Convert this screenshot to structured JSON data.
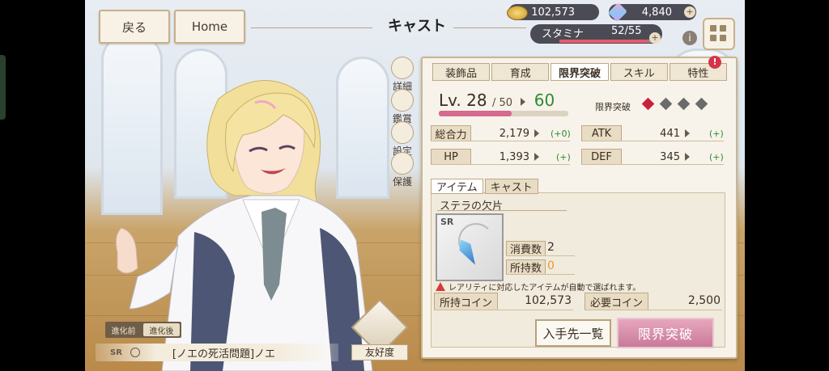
{
  "header": {
    "back_label": "戻る",
    "home_label": "Home",
    "title": "キャスト",
    "coins": "102,573",
    "gems": "4,840",
    "stamina_label": "スタミナ",
    "stamina_value": "52/55",
    "stamina_fraction": 0.945,
    "info_symbol": "i",
    "plus_symbol": "+"
  },
  "side_menu": [
    {
      "label": "詳細",
      "icon": "gear-icon"
    },
    {
      "label": "鑑賞",
      "icon": "magnifier-icon"
    },
    {
      "label": "設定",
      "icon": "house-icon"
    },
    {
      "label": "保護",
      "icon": "lock-icon"
    }
  ],
  "character": {
    "evo_before": "進化前",
    "evo_after": "進化後",
    "rarity": "SR",
    "name": "[ノエの死活問題]ノエ",
    "affinity_label": "友好度"
  },
  "panel": {
    "tabs": [
      "装飾品",
      "育成",
      "限界突破",
      "スキル",
      "特性"
    ],
    "active_tab": "限界突破",
    "alert_symbol": "!",
    "level_prefix": "Lv.",
    "level": "28",
    "level_max": "/ 50",
    "level_next": "60",
    "level_fraction": 0.56,
    "limit_break_label": "限界突破",
    "limit_break_filled": 1,
    "limit_break_total": 4,
    "stats": [
      {
        "label": "総合力",
        "value": "2,179",
        "delta": "(+0)"
      },
      {
        "label": "ATK",
        "value": "441",
        "delta": "(+)"
      },
      {
        "label": "HP",
        "value": "1,393",
        "delta": "(+)"
      },
      {
        "label": "DEF",
        "value": "345",
        "delta": "(+)"
      }
    ],
    "subtabs": [
      "アイテム",
      "キャスト"
    ],
    "item_name": "ステラの欠片",
    "item_rarity": "SR",
    "consume_label": "消費数",
    "consume_value": "2",
    "owned_label": "所持数",
    "owned_value": "0",
    "warning": "レアリティに対応したアイテムが自動で選ばれます。",
    "owned_coins_label": "所持コイン",
    "owned_coins": "102,573",
    "required_coins_label": "必要コイン",
    "required_coins": "2,500",
    "acquire_button": "入手先一覧",
    "limit_break_button": "限界突破"
  },
  "colors": {
    "accent_pink": "#c97a98",
    "panel_bg": "#f7f3ea",
    "border_gold": "#c9b690",
    "green": "#2e8c2e",
    "limit_red": "#c8223a",
    "owned_zero": "#e59a2a"
  }
}
